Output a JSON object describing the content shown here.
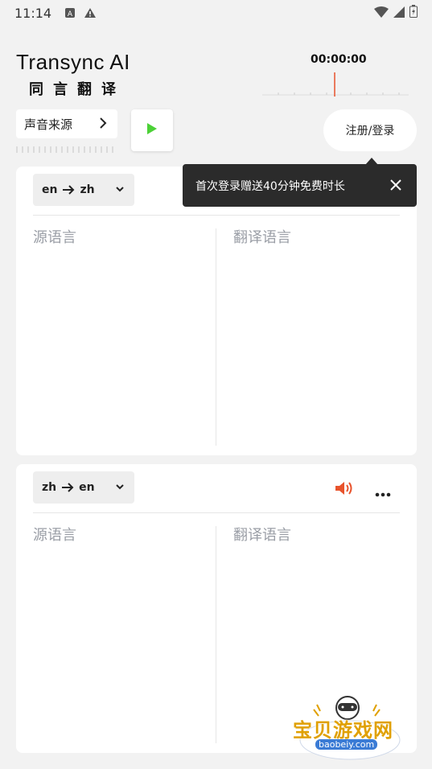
{
  "status_bar": {
    "time": "11:14",
    "icons": [
      "a-icon",
      "warning-icon"
    ],
    "right_icons": [
      "wifi-icon",
      "signal-icon",
      "battery-icon"
    ]
  },
  "brand": {
    "name_en": "Transync AI",
    "name_cn": "同言翻译"
  },
  "timer": "00:00:00",
  "source_button": {
    "label": "声音来源",
    "icon": "chevron-right-icon"
  },
  "play_button": {
    "icon": "play-icon",
    "color": "#4cd137"
  },
  "login_button": {
    "label": "注册/登录"
  },
  "toast": {
    "message": "首次登录赠送40分钟免费时长",
    "close_icon": "close-icon"
  },
  "panels": [
    {
      "lang_from": "en",
      "lang_to": "zh",
      "source_placeholder": "源语言",
      "target_placeholder": "翻译语言"
    },
    {
      "lang_from": "zh",
      "lang_to": "en",
      "source_placeholder": "源语言",
      "target_placeholder": "翻译语言",
      "speaker_icon": "speaker-icon",
      "more_icon": "more-icon"
    }
  ],
  "watermark": {
    "text": "宝贝游戏网",
    "url": "baobeiy.com"
  },
  "colors": {
    "accent": "#e8532c",
    "background": "#f2f2f2",
    "toast_bg": "#2b2b2b"
  }
}
